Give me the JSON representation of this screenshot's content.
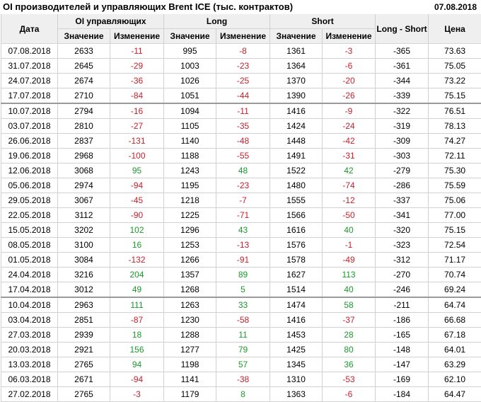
{
  "title": "OI производителей и управляющих Brent ICE (тыс. контрактов)",
  "date": "07.08.2018",
  "headers": {
    "date": "Дата",
    "oi": "OI управляющих",
    "long": "Long",
    "short": "Short",
    "long_short": "Long - Short",
    "price": "Цена",
    "value": "Значение",
    "change": "Изменение"
  },
  "colors": {
    "negative": "#c8202a",
    "positive": "#1a9a2a"
  },
  "rows": [
    {
      "date": "07.08.2018",
      "oi": "2633",
      "oi_chg": "-11",
      "long": "995",
      "long_chg": "-8",
      "short": "1361",
      "short_chg": "-3",
      "ls": "-365",
      "price": "73.63"
    },
    {
      "date": "31.07.2018",
      "oi": "2645",
      "oi_chg": "-29",
      "long": "1003",
      "long_chg": "-23",
      "short": "1364",
      "short_chg": "-6",
      "ls": "-361",
      "price": "75.05"
    },
    {
      "date": "24.07.2018",
      "oi": "2674",
      "oi_chg": "-36",
      "long": "1026",
      "long_chg": "-25",
      "short": "1370",
      "short_chg": "-20",
      "ls": "-344",
      "price": "73.22"
    },
    {
      "date": "17.07.2018",
      "oi": "2710",
      "oi_chg": "-84",
      "long": "1051",
      "long_chg": "-44",
      "short": "1390",
      "short_chg": "-26",
      "ls": "-339",
      "price": "75.15"
    },
    {
      "date": "10.07.2018",
      "oi": "2794",
      "oi_chg": "-16",
      "long": "1094",
      "long_chg": "-11",
      "short": "1416",
      "short_chg": "-9",
      "ls": "-322",
      "price": "76.51"
    },
    {
      "date": "03.07.2018",
      "oi": "2810",
      "oi_chg": "-27",
      "long": "1105",
      "long_chg": "-35",
      "short": "1424",
      "short_chg": "-24",
      "ls": "-319",
      "price": "78.13"
    },
    {
      "date": "26.06.2018",
      "oi": "2837",
      "oi_chg": "-131",
      "long": "1140",
      "long_chg": "-48",
      "short": "1448",
      "short_chg": "-42",
      "ls": "-309",
      "price": "74.27"
    },
    {
      "date": "19.06.2018",
      "oi": "2968",
      "oi_chg": "-100",
      "long": "1188",
      "long_chg": "-55",
      "short": "1491",
      "short_chg": "-31",
      "ls": "-303",
      "price": "72.11"
    },
    {
      "date": "12.06.2018",
      "oi": "3068",
      "oi_chg": "95",
      "long": "1243",
      "long_chg": "48",
      "short": "1522",
      "short_chg": "42",
      "ls": "-279",
      "price": "75.30"
    },
    {
      "date": "05.06.2018",
      "oi": "2974",
      "oi_chg": "-94",
      "long": "1195",
      "long_chg": "-23",
      "short": "1480",
      "short_chg": "-74",
      "ls": "-286",
      "price": "75.59"
    },
    {
      "date": "29.05.2018",
      "oi": "3067",
      "oi_chg": "-45",
      "long": "1218",
      "long_chg": "-7",
      "short": "1555",
      "short_chg": "-12",
      "ls": "-337",
      "price": "75.06"
    },
    {
      "date": "22.05.2018",
      "oi": "3112",
      "oi_chg": "-90",
      "long": "1225",
      "long_chg": "-71",
      "short": "1566",
      "short_chg": "-50",
      "ls": "-341",
      "price": "77.00"
    },
    {
      "date": "15.05.2018",
      "oi": "3202",
      "oi_chg": "102",
      "long": "1296",
      "long_chg": "43",
      "short": "1616",
      "short_chg": "40",
      "ls": "-320",
      "price": "75.15"
    },
    {
      "date": "08.05.2018",
      "oi": "3100",
      "oi_chg": "16",
      "long": "1253",
      "long_chg": "-13",
      "short": "1576",
      "short_chg": "-1",
      "ls": "-323",
      "price": "72.54"
    },
    {
      "date": "01.05.2018",
      "oi": "3084",
      "oi_chg": "-132",
      "long": "1266",
      "long_chg": "-91",
      "short": "1578",
      "short_chg": "-49",
      "ls": "-312",
      "price": "71.17"
    },
    {
      "date": "24.04.2018",
      "oi": "3216",
      "oi_chg": "204",
      "long": "1357",
      "long_chg": "89",
      "short": "1627",
      "short_chg": "113",
      "ls": "-270",
      "price": "70.74"
    },
    {
      "date": "17.04.2018",
      "oi": "3012",
      "oi_chg": "49",
      "long": "1268",
      "long_chg": "5",
      "short": "1514",
      "short_chg": "40",
      "ls": "-246",
      "price": "69.24"
    },
    {
      "date": "10.04.2018",
      "oi": "2963",
      "oi_chg": "111",
      "long": "1263",
      "long_chg": "33",
      "short": "1474",
      "short_chg": "58",
      "ls": "-211",
      "price": "64.74"
    },
    {
      "date": "03.04.2018",
      "oi": "2851",
      "oi_chg": "-87",
      "long": "1230",
      "long_chg": "-58",
      "short": "1416",
      "short_chg": "-37",
      "ls": "-186",
      "price": "66.68"
    },
    {
      "date": "27.03.2018",
      "oi": "2939",
      "oi_chg": "18",
      "long": "1288",
      "long_chg": "11",
      "short": "1453",
      "short_chg": "28",
      "ls": "-165",
      "price": "67.18"
    },
    {
      "date": "20.03.2018",
      "oi": "2921",
      "oi_chg": "156",
      "long": "1277",
      "long_chg": "79",
      "short": "1425",
      "short_chg": "80",
      "ls": "-148",
      "price": "64.01"
    },
    {
      "date": "13.03.2018",
      "oi": "2765",
      "oi_chg": "94",
      "long": "1198",
      "long_chg": "57",
      "short": "1345",
      "short_chg": "36",
      "ls": "-147",
      "price": "63.29"
    },
    {
      "date": "06.03.2018",
      "oi": "2671",
      "oi_chg": "-94",
      "long": "1141",
      "long_chg": "-38",
      "short": "1310",
      "short_chg": "-53",
      "ls": "-169",
      "price": "62.10"
    },
    {
      "date": "27.02.2018",
      "oi": "2765",
      "oi_chg": "-3",
      "long": "1179",
      "long_chg": "8",
      "short": "1363",
      "short_chg": "-6",
      "ls": "-184",
      "price": "64.47"
    }
  ]
}
